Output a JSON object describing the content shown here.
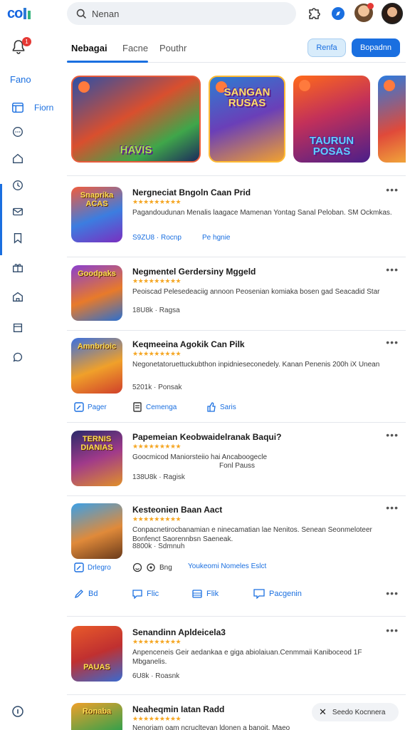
{
  "logo": {
    "text": "co"
  },
  "search": {
    "value": "Nenan"
  },
  "sidebar": {
    "title": "Fano",
    "active_label": "Fiorn"
  },
  "tabs": [
    {
      "label": "Nebagai"
    },
    {
      "label": "Facne"
    },
    {
      "label": "Pouthr"
    }
  ],
  "buttons": {
    "light": "Renfa",
    "primary": "Bopadnn"
  },
  "featured": [
    {
      "title": "HAVIS"
    },
    {
      "title": "SANGAN RUSAS"
    },
    {
      "title": "TAURUN POSAS"
    }
  ],
  "rows": [
    {
      "thumb_text": "Snaprika ACAS",
      "title": "Nergneciat Bngoln Caan Prid",
      "stars": "★★★★★★★★★",
      "desc": "Pagandoudunan Menalis laagace Mamenan Yontag Sanal Peloban. SM Ockmkas.",
      "meta": "",
      "link1": "S9ZU8 · Rocnp",
      "link2": "Pe hgnie"
    },
    {
      "thumb_text": "Goodpaks",
      "title": "Negmentel Gerdersiny Mggeld",
      "stars": "★★★★★★★★★",
      "desc": "Peoiscad Pelesedeaciig annoon Peosenian komiaka bosen gad Seacadid Star",
      "meta": "18U8k · Ragsa"
    },
    {
      "thumb_text": "Amnbrioic",
      "title": "Keqmeeina Agokik Can Pilk",
      "stars": "★★★★★★★★★",
      "desc": "Negonetatoruettuckubthon inpidnieseconedely. Kanan Penenis 200h iX Unean",
      "meta": "5201k · Ponsak",
      "act1": "Pager",
      "act2": "Cemenga",
      "act3": "Saris"
    },
    {
      "thumb_text": "TERNIS DIANIAS",
      "title": "Papemeian Keobwaidelranak Baqui?",
      "stars": "★★★★★★★★★",
      "desc": "Goocmicod Maniorsteiio hai Ancaboogecle",
      "desc2": "Fonl Pauss",
      "meta": "138U8k · Ragisk"
    },
    {
      "thumb_text": "",
      "title": "Kesteonien Baan Aact",
      "stars": "★★★★★★★★★",
      "desc": "Conpacnetirocbanamian e ninecamatian lae Nenitos. Senean Seonmeloteer Bonfenct Saorennbsn Saeneak.",
      "meta": "8800k · Sdmnuh",
      "act1": "Drlegro",
      "act2": "Bng",
      "act3": "Youkeomi Nomeles Eslct"
    },
    {
      "thumb_text": "PAUAS",
      "title": "Senandinn Apldeicela3",
      "stars": "★★★★★★★★★",
      "desc": "Anpenceneis Geir aedankaa e giga abiolaiuan.Cenmmaii Kaniboceod 1F Mbganelis.",
      "meta": "6U8k · Roasnk"
    },
    {
      "thumb_text": "Ronaba",
      "title": "Neaheqmin Iatan Radd",
      "stars": "★★★★★★★★★",
      "desc": "Nenoriam oam ncrucltevan ldonen a banoit. Maeo"
    }
  ],
  "actionbar": [
    {
      "label": "Bd"
    },
    {
      "label": "Flic"
    },
    {
      "label": "Flik"
    },
    {
      "label": "Pacgenin"
    }
  ],
  "chip": {
    "label": "Seedo   Kocnnera"
  },
  "colors": {
    "accent": "#1a6fe0",
    "star": "#f5a623",
    "badge": "#e53935"
  }
}
